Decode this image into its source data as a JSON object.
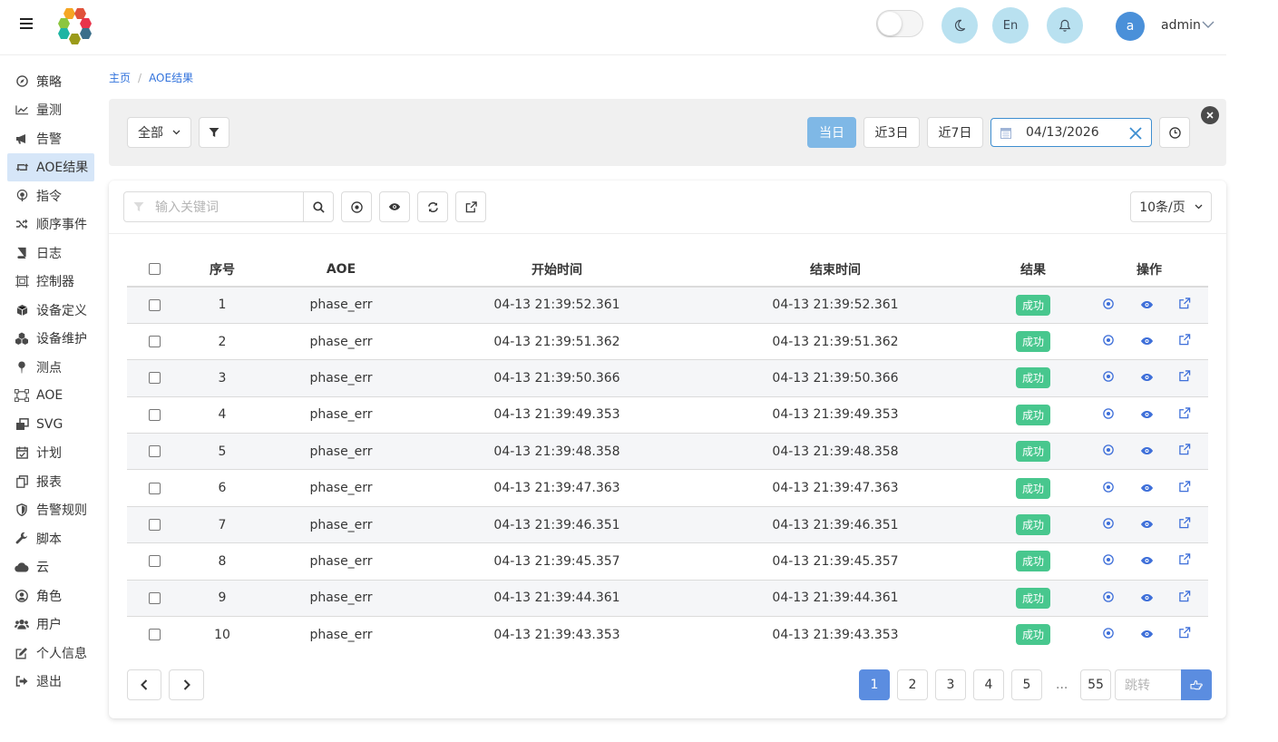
{
  "header": {
    "theme_btn": "moon-icon",
    "lang_label": "En",
    "user_initial": "a",
    "user_name": "admin"
  },
  "sidebar": {
    "items": [
      {
        "label": "策略",
        "icon": "compass-icon"
      },
      {
        "label": "量测",
        "icon": "chart-line-icon"
      },
      {
        "label": "告警",
        "icon": "bullhorn-icon"
      },
      {
        "label": "AOE结果",
        "icon": "retweet-icon",
        "active": true
      },
      {
        "label": "指令",
        "icon": "podcast-icon"
      },
      {
        "label": "顺序事件",
        "icon": "random-icon"
      },
      {
        "label": "日志",
        "icon": "book-icon"
      },
      {
        "label": "控制器",
        "icon": "frame-icon"
      },
      {
        "label": "设备定义",
        "icon": "cube-icon"
      },
      {
        "label": "设备维护",
        "icon": "cubes-icon"
      },
      {
        "label": "测点",
        "icon": "pin-icon"
      },
      {
        "label": "AOE",
        "icon": "vector-icon"
      },
      {
        "label": "SVG",
        "icon": "clone-icon"
      },
      {
        "label": "计划",
        "icon": "calendar-check-icon"
      },
      {
        "label": "报表",
        "icon": "copy-icon"
      },
      {
        "label": "告警规则",
        "icon": "shield-icon"
      },
      {
        "label": "脚本",
        "icon": "wrench-icon"
      },
      {
        "label": "云",
        "icon": "cloud-icon"
      },
      {
        "label": "角色",
        "icon": "user-circle-icon"
      },
      {
        "label": "用户",
        "icon": "users-icon"
      },
      {
        "label": "个人信息",
        "icon": "edit-icon"
      },
      {
        "label": "退出",
        "icon": "sign-out-icon"
      }
    ]
  },
  "breadcrumb": {
    "home": "主页",
    "current": "AOE结果"
  },
  "filter": {
    "scope": "全部",
    "today": "当日",
    "last3": "近3日",
    "last7": "近7日",
    "date": "04/13/2026"
  },
  "toolbar": {
    "search_placeholder": "输入关键词",
    "page_size": "10条/页"
  },
  "table": {
    "headers": [
      "序号",
      "AOE",
      "开始时间",
      "结束时间",
      "结果",
      "操作"
    ],
    "rows": [
      {
        "no": "1",
        "aoe": "phase_err",
        "start": "04-13 21:39:52.361",
        "end": "04-13 21:39:52.361",
        "result": "成功"
      },
      {
        "no": "2",
        "aoe": "phase_err",
        "start": "04-13 21:39:51.362",
        "end": "04-13 21:39:51.362",
        "result": "成功"
      },
      {
        "no": "3",
        "aoe": "phase_err",
        "start": "04-13 21:39:50.366",
        "end": "04-13 21:39:50.366",
        "result": "成功"
      },
      {
        "no": "4",
        "aoe": "phase_err",
        "start": "04-13 21:39:49.353",
        "end": "04-13 21:39:49.353",
        "result": "成功"
      },
      {
        "no": "5",
        "aoe": "phase_err",
        "start": "04-13 21:39:48.358",
        "end": "04-13 21:39:48.358",
        "result": "成功"
      },
      {
        "no": "6",
        "aoe": "phase_err",
        "start": "04-13 21:39:47.363",
        "end": "04-13 21:39:47.363",
        "result": "成功"
      },
      {
        "no": "7",
        "aoe": "phase_err",
        "start": "04-13 21:39:46.351",
        "end": "04-13 21:39:46.351",
        "result": "成功"
      },
      {
        "no": "8",
        "aoe": "phase_err",
        "start": "04-13 21:39:45.357",
        "end": "04-13 21:39:45.357",
        "result": "成功"
      },
      {
        "no": "9",
        "aoe": "phase_err",
        "start": "04-13 21:39:44.361",
        "end": "04-13 21:39:44.361",
        "result": "成功"
      },
      {
        "no": "10",
        "aoe": "phase_err",
        "start": "04-13 21:39:43.353",
        "end": "04-13 21:39:43.353",
        "result": "成功"
      }
    ]
  },
  "pagination": {
    "pages": [
      "1",
      "2",
      "3",
      "4",
      "5"
    ],
    "ellipsis": "...",
    "last": "55",
    "jump_placeholder": "跳转"
  },
  "colors": {
    "accent": "#5b8de0",
    "success": "#48c78e",
    "active_filter": "#7fb8e6"
  }
}
